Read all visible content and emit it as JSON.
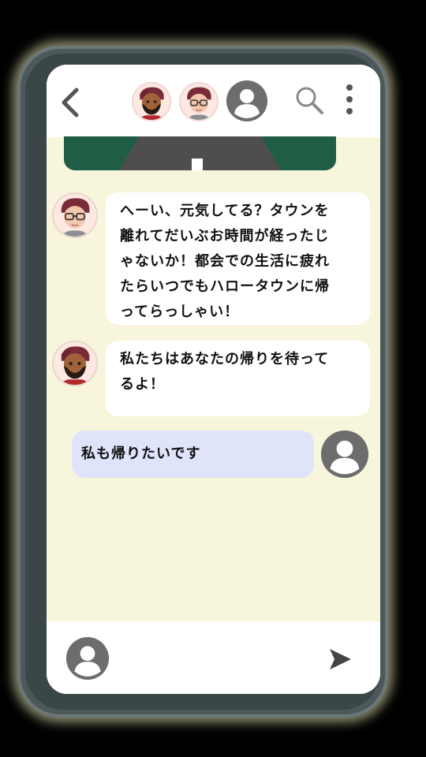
{
  "header": {
    "back_icon": "chevron-left-icon",
    "participants": [
      {
        "name_icon": "avatar-bearded-man"
      },
      {
        "name_icon": "avatar-glasses-man"
      },
      {
        "name_icon": "avatar-default-user"
      }
    ],
    "search_icon": "search-icon",
    "more_icon": "more-vertical-icon"
  },
  "messages": [
    {
      "sender_icon": "avatar-glasses-man",
      "lines": [
        "へーい、元気してる？タウンを",
        "離れてだいぶお時間が経ったじ",
        "ゃないか！都会での生活に疲れ",
        "たらいつでもハロータウンに帰",
        "ってらっしゃい！"
      ]
    },
    {
      "sender_icon": "avatar-bearded-man",
      "lines": [
        "私たちはあなたの帰りを待って",
        "るよ！"
      ]
    },
    {
      "sender_icon": "avatar-default-user",
      "lines": [
        "私も帰りたいです"
      ]
    }
  ],
  "composer": {
    "user_icon": "avatar-default-user",
    "send_icon": "send-icon"
  },
  "colors": {
    "screen_bg": "#f8f5dd",
    "bubble_in": "#ffffff",
    "bubble_out": "#dfe4fb",
    "icon_gray": "#6d6d6d"
  }
}
